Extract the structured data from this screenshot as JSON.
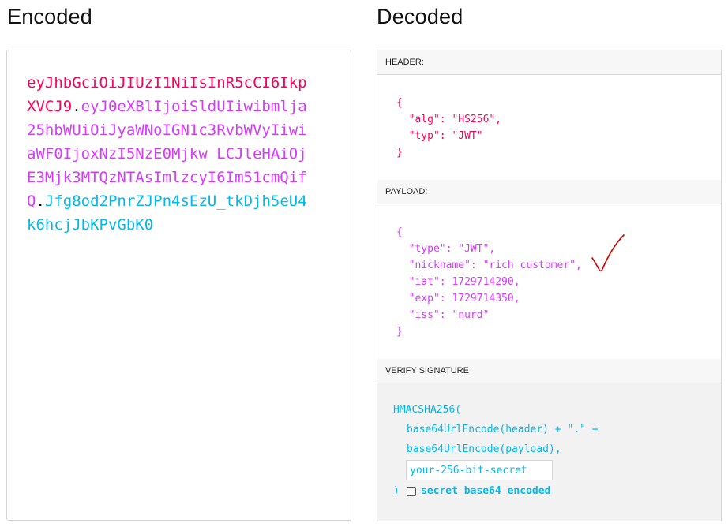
{
  "encoded": {
    "title": "Encoded",
    "token": {
      "header": "eyJhbGciOiJIUzI1NiIsInR5cCI6IkpXVCJ9",
      "dot1": ".",
      "payload": "eyJ0eXBlIjoiSldUIiwibmlja25hbWUiOiJyaWNoIGN1c3RvbWVyIiwiaWF0IjoxNzI5NzE0Mjkw LCJleHAiOjE3Mjk3MTQzNTAsImlzcyI6Im51cmQifQ",
      "dot2": ".",
      "signature": "Jfg8od2PnrZJPn4sEzU_tkDjh5eU4k6hcjJbKPvGbK0"
    }
  },
  "decoded": {
    "title": "Decoded",
    "header": {
      "label": "HEADER:",
      "open": "{",
      "lines": [
        "\"alg\": \"HS256\",",
        "\"typ\": \"JWT\""
      ],
      "close": "}"
    },
    "payload": {
      "label": "PAYLOAD:",
      "open": "{",
      "lines": [
        "\"type\": \"JWT\",",
        "\"nickname\": \"rich customer\",",
        "\"iat\": 1729714290,",
        "\"exp\": 1729714350,",
        "\"iss\": \"nurd\""
      ],
      "close": "}"
    },
    "verify": {
      "label": "VERIFY SIGNATURE",
      "fn": "HMACSHA256(",
      "line1": "base64UrlEncode(header) + \".\" +",
      "line2": "base64UrlEncode(payload),",
      "secret_placeholder": "your-256-bit-secret",
      "secret_value": "",
      "close": ")",
      "checkbox_label": "secret base64 encoded",
      "checkbox_checked": false
    }
  },
  "annotation": {
    "icon": "red-checkmark-icon",
    "color": "#cc0000"
  },
  "colors": {
    "header": "#fb015b",
    "payload": "#d63aff",
    "signature": "#00b9f1"
  }
}
